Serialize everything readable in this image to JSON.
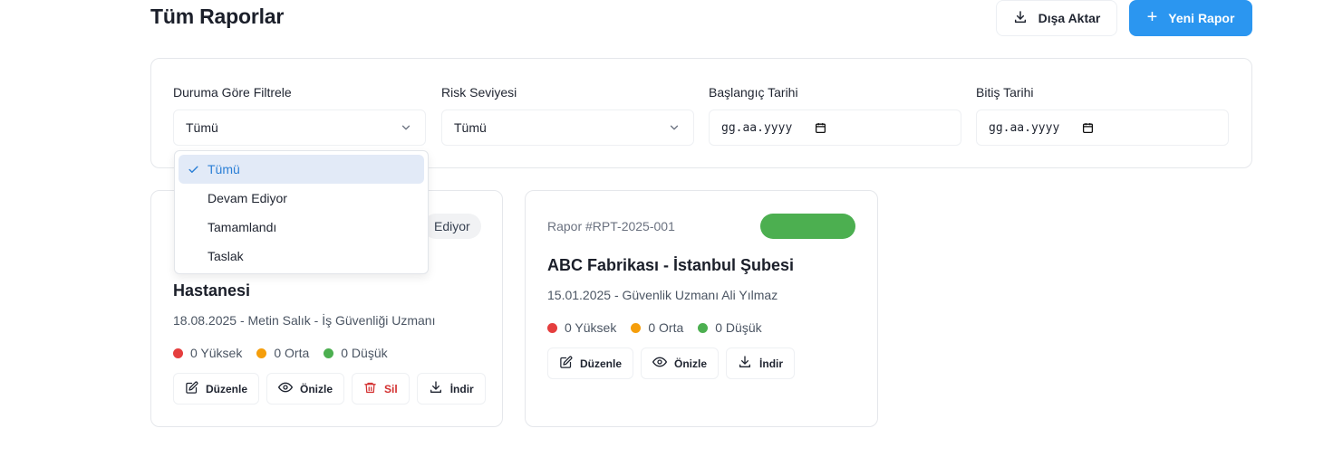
{
  "header": {
    "title": "Tüm Raporlar",
    "export_label": "Dışa Aktar",
    "new_label": "Yeni Rapor"
  },
  "filters": {
    "status": {
      "label": "Duruma Göre Filtrele",
      "value": "Tümü"
    },
    "risk": {
      "label": "Risk Seviyesi",
      "value": "Tümü"
    },
    "start_date": {
      "label": "Başlangıç Tarihi",
      "value": "gg.aa.yyyy"
    },
    "end_date": {
      "label": "Bitiş Tarihi",
      "value": "gg.aa.yyyy"
    }
  },
  "status_dropdown": {
    "selected": "Tümü",
    "options": [
      "Tümü",
      "Devam Ediyor",
      "Tamamlandı",
      "Taslak"
    ]
  },
  "reports": [
    {
      "status": "Ediyor",
      "title": "Hastanesi",
      "meta": "18.08.2025 - Metin Salık - İş Güvenliği Uzmanı",
      "risk": {
        "high": "0 Yüksek",
        "medium": "0 Orta",
        "low": "0 Düşük"
      },
      "actions": {
        "edit": "Düzenle",
        "preview": "Önizle",
        "delete": "Sil",
        "download": "İndir"
      }
    },
    {
      "id": "Rapor #RPT-2025-001",
      "status": "",
      "title": "ABC Fabrikası - İstanbul Şubesi",
      "meta": "15.01.2025 - Güvenlik Uzmanı Ali Yılmaz",
      "risk": {
        "high": "0 Yüksek",
        "medium": "0 Orta",
        "low": "0 Düşük"
      },
      "actions": {
        "edit": "Düzenle",
        "preview": "Önizle",
        "download": "İndir"
      }
    }
  ],
  "colors": {
    "accent": "#2b96f0",
    "high": "#e53e3e",
    "medium": "#f59e0b",
    "low": "#4caf50",
    "status_completed": "#4caf50",
    "danger": "#d32f2f"
  },
  "icons": {
    "export": "download-icon",
    "new": "plus-icon",
    "select": "chevron-down-icon",
    "date": "calendar-icon",
    "edit": "edit-icon",
    "preview": "eye-icon",
    "delete": "trash-icon",
    "download": "download-icon",
    "selected_option": "check-icon"
  }
}
